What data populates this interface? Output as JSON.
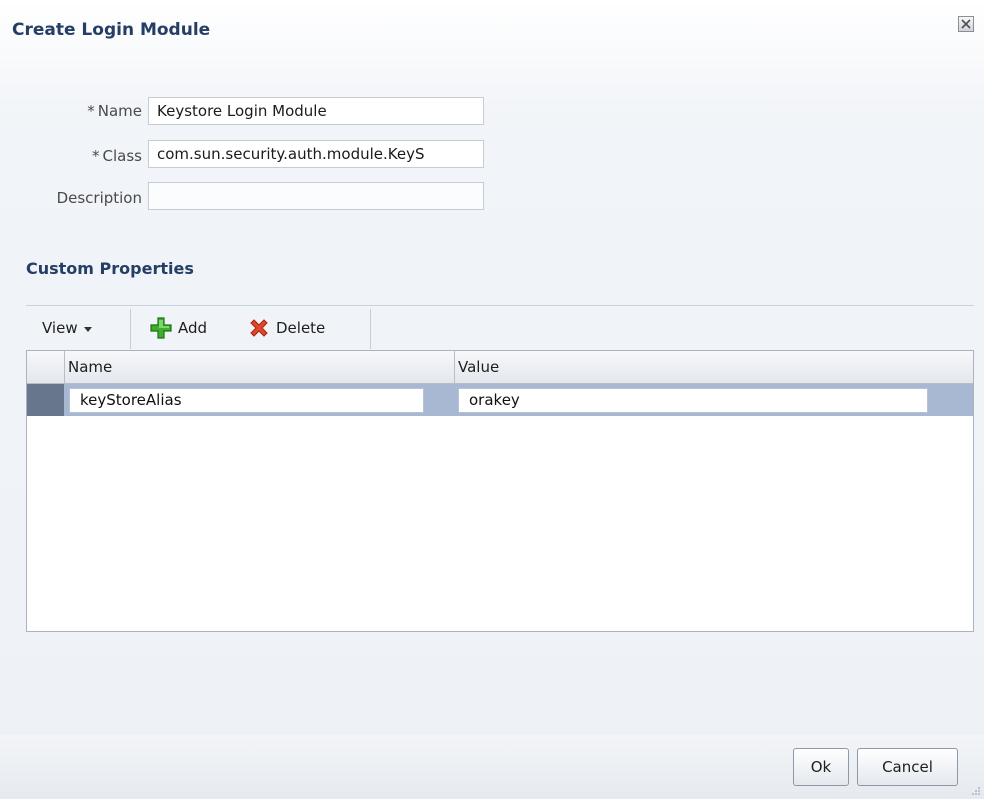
{
  "dialog": {
    "title": "Create Login Module",
    "close_icon": "close-icon"
  },
  "form": {
    "name": {
      "required_mark": "*",
      "label": "Name",
      "value": "Keystore Login Module"
    },
    "class": {
      "required_mark": "*",
      "label": "Class",
      "value": "com.sun.security.auth.module.KeyS"
    },
    "description": {
      "label": "Description",
      "value": ""
    }
  },
  "custom_properties": {
    "title": "Custom Properties",
    "toolbar": {
      "view_label": "View",
      "add_label": "Add",
      "delete_label": "Delete"
    },
    "table": {
      "columns": [
        "Name",
        "Value"
      ],
      "rows": [
        {
          "name": "keyStoreAlias",
          "value": "orakey",
          "selected": true
        }
      ]
    }
  },
  "footer": {
    "ok_label": "Ok",
    "cancel_label": "Cancel"
  },
  "colors": {
    "title": "#243e66",
    "selected_row": "#a8b8d3",
    "row_header": "#67768c"
  }
}
